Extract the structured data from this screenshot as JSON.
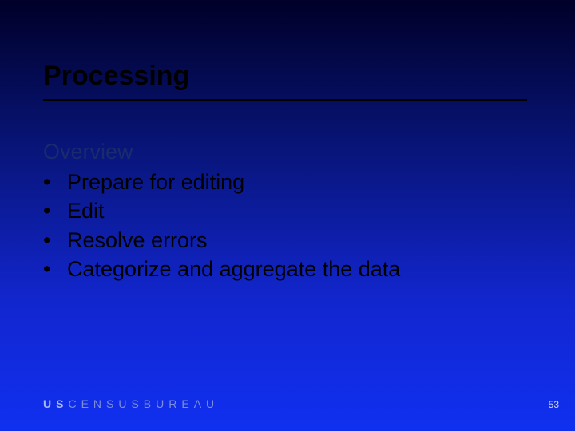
{
  "title": "Processing",
  "subtitle": "Overview",
  "bullets": [
    "Prepare for editing",
    "Edit",
    "Resolve errors",
    "Categorize and aggregate the data"
  ],
  "footer": {
    "us": "US",
    "rest": "CENSUSBUREAU"
  },
  "page_number": "53"
}
